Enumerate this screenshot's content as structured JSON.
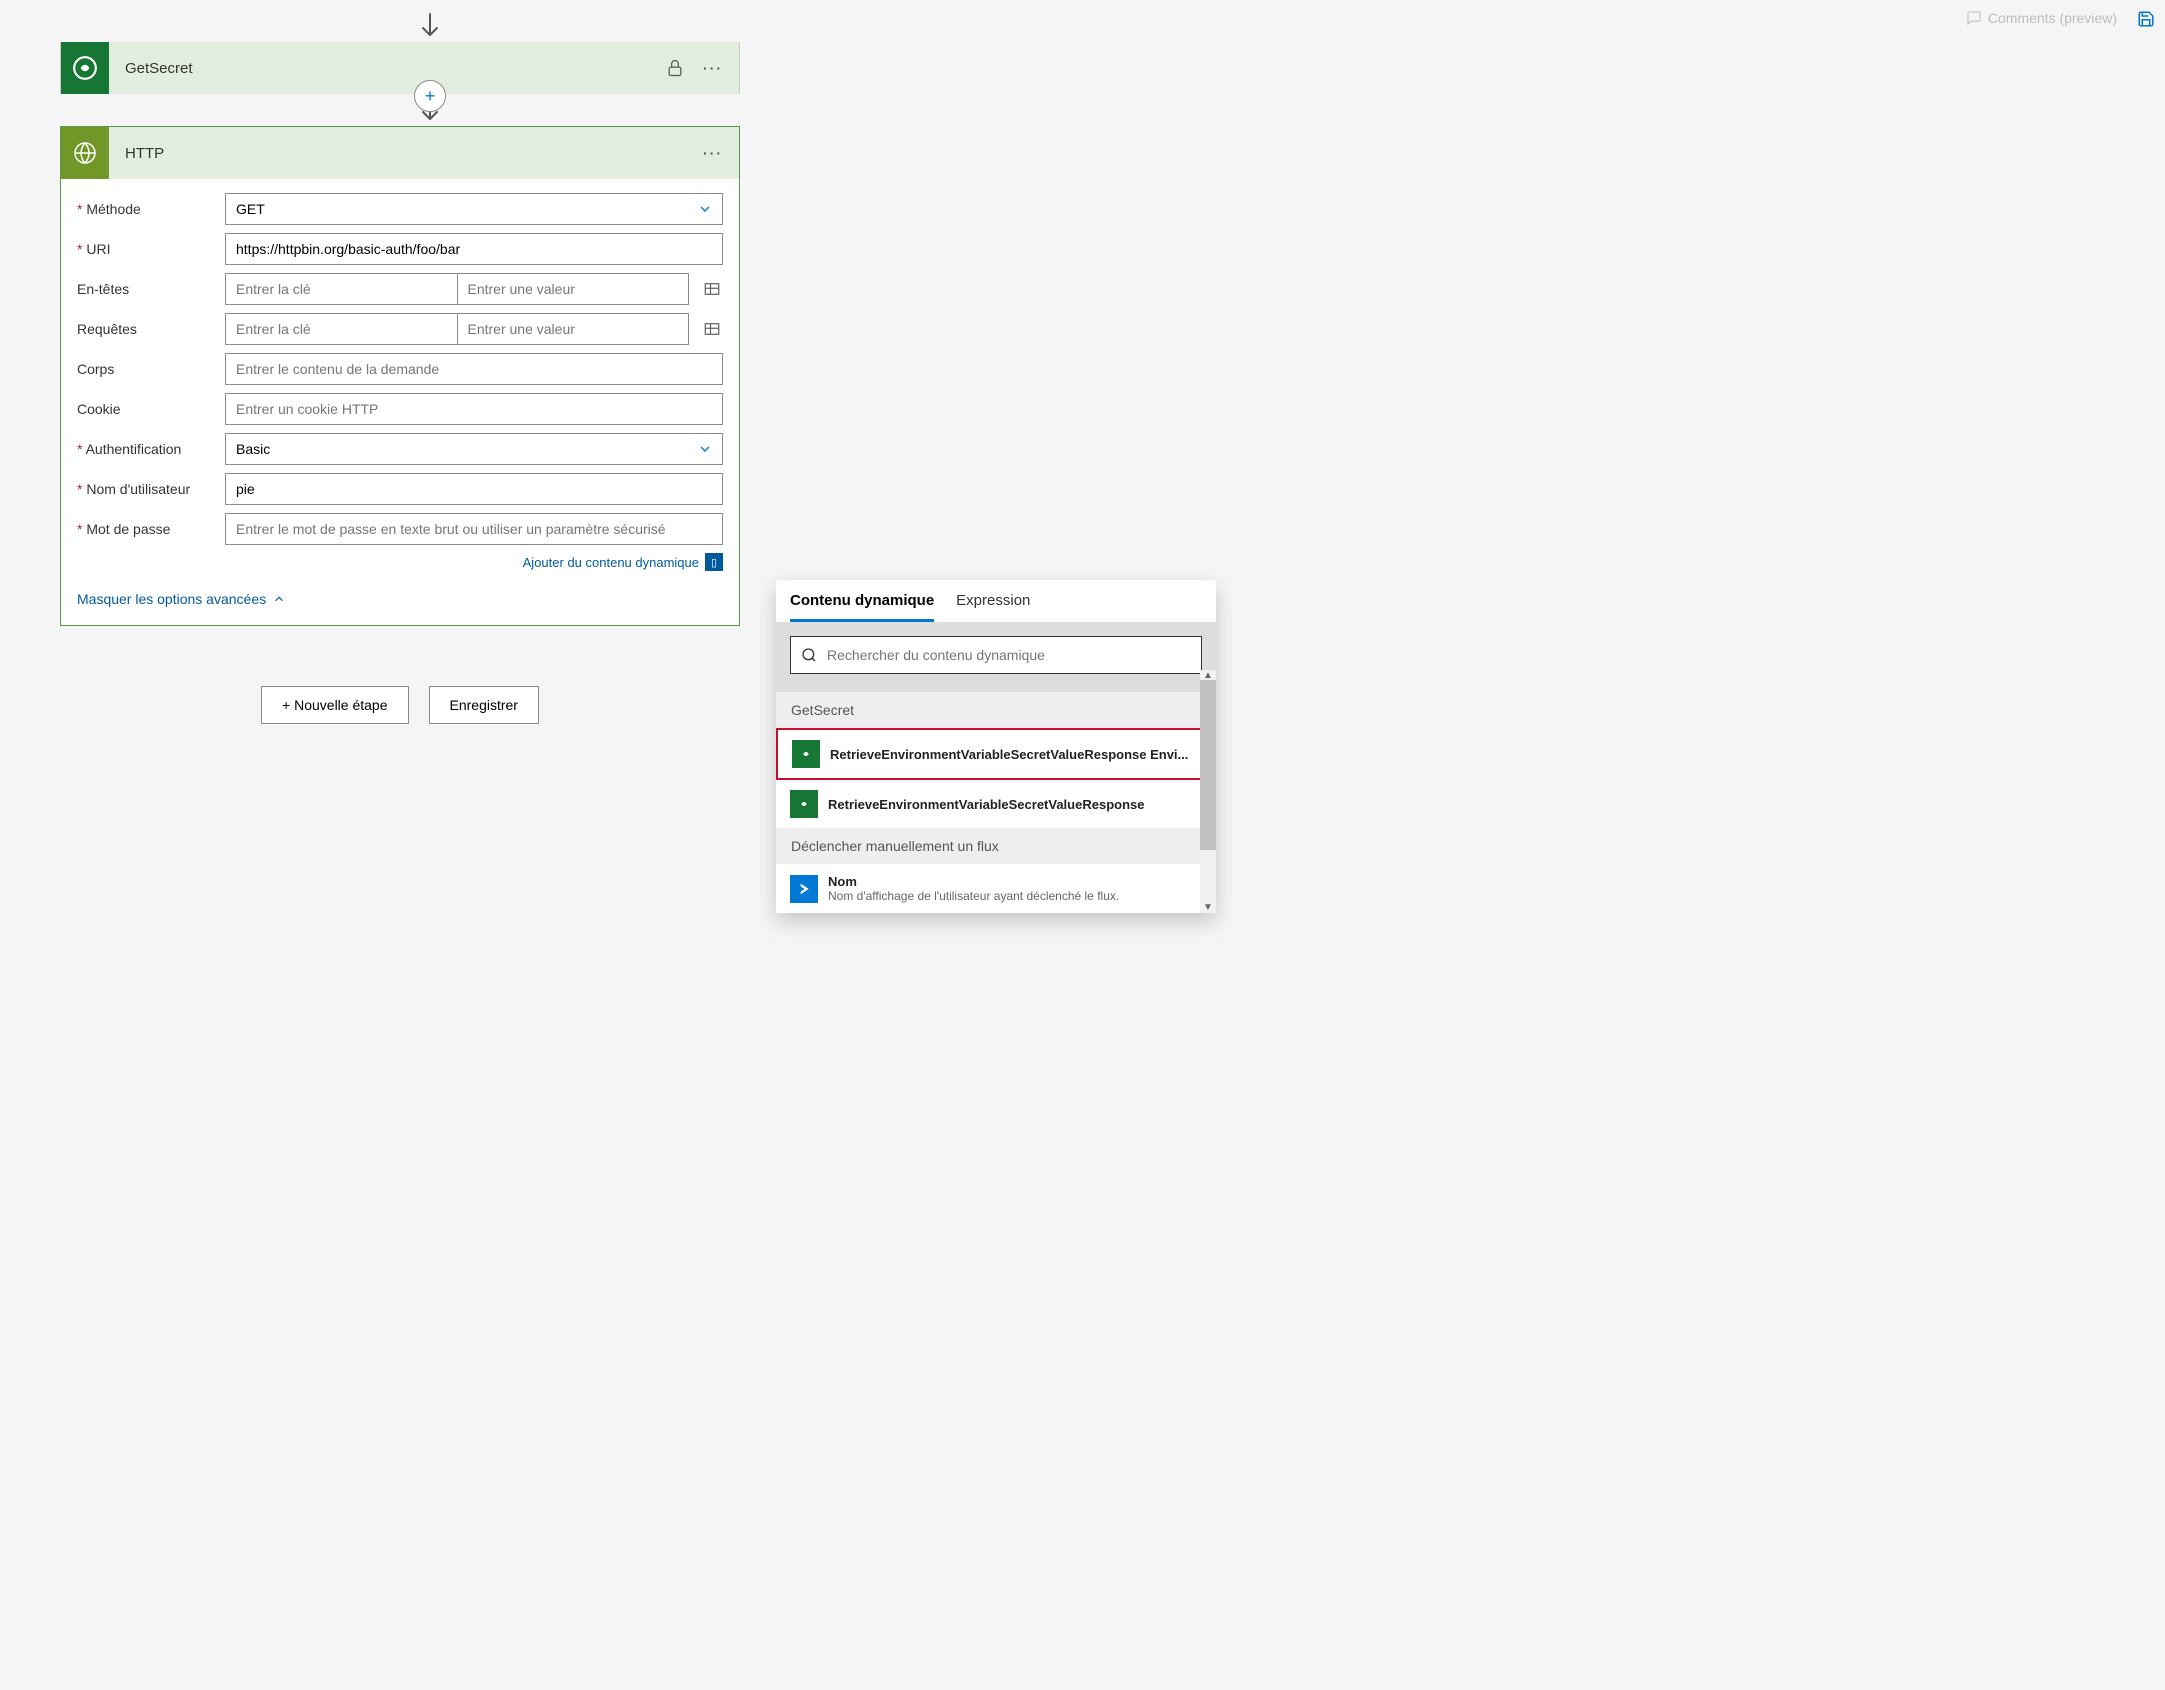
{
  "topbar": {
    "comments": "Comments (preview)"
  },
  "getsecret_card": {
    "title": "GetSecret"
  },
  "http_card": {
    "title": "HTTP",
    "method": {
      "label": "Méthode",
      "value": "GET"
    },
    "uri": {
      "label": "URI",
      "value": "https://httpbin.org/basic-auth/foo/bar"
    },
    "headers": {
      "label": "En-têtes",
      "key_placeholder": "Entrer la clé",
      "value_placeholder": "Entrer une valeur"
    },
    "queries": {
      "label": "Requêtes",
      "key_placeholder": "Entrer la clé",
      "value_placeholder": "Entrer une valeur"
    },
    "body": {
      "label": "Corps",
      "placeholder": "Entrer le contenu de la demande"
    },
    "cookie": {
      "label": "Cookie",
      "placeholder": "Entrer un cookie HTTP"
    },
    "auth": {
      "label": "Authentification",
      "value": "Basic"
    },
    "username": {
      "label": "Nom d'utilisateur",
      "value": "pie"
    },
    "password": {
      "label": "Mot de passe",
      "placeholder": "Entrer le mot de passe en texte brut ou utiliser un paramètre sécurisé"
    },
    "add_dynamic": "Ajouter du contenu dynamique",
    "hide_advanced": "Masquer les options avancées"
  },
  "footer": {
    "new_step": "+ Nouvelle étape",
    "save": "Enregistrer"
  },
  "dyn_panel": {
    "tab_dynamic": "Contenu dynamique",
    "tab_expression": "Expression",
    "search_placeholder": "Rechercher du contenu dynamique",
    "sections": {
      "getsecret": "GetSecret",
      "trigger": "Déclencher manuellement un flux"
    },
    "items": {
      "envvar_trunc": "RetrieveEnvironmentVariableSecretValueResponse Envi...",
      "envvar": "RetrieveEnvironmentVariableSecretValueResponse",
      "nom_title": "Nom",
      "nom_subtitle": "Nom d'affichage de l'utilisateur ayant déclenché le flux."
    }
  }
}
